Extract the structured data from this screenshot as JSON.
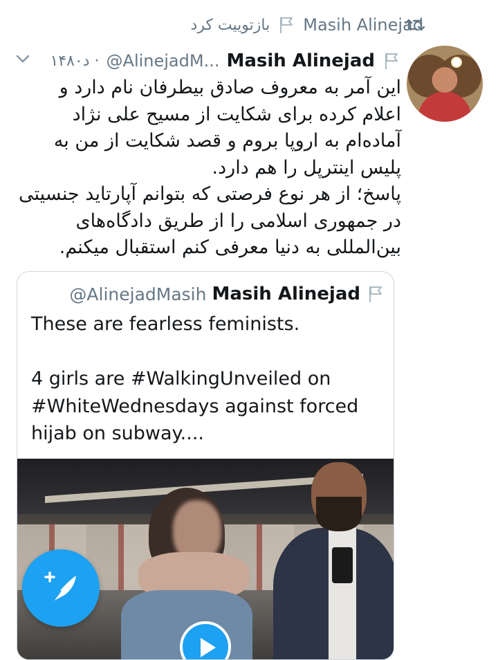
{
  "retweet": {
    "label": "بازتوییت کرد",
    "user": "Masih Alinejad"
  },
  "tweet": {
    "author_name": "Masih Alinejad",
    "handle": "@AlinejadM...",
    "time": "۱۴۸۰د ·",
    "text": "این آمر به معروف صادق بیطرفان نام دارد و اعلام کرده برای شکایت از مسیح علی نژاد آماده‌ام به اروپا بروم و قصد شکایت از من به پلیس اینترپل را هم دارد.\nپاسخ؛ از هر نوع فرصتی که بتوانم آپارتاید جنسیتی در جمهوری اسلامی را از طریق دادگاه‌های بین‌المللی به دنیا معرفی کنم استقبال میکنم."
  },
  "quoted": {
    "author_name": "Masih Alinejad",
    "handle": "@AlinejadMasih",
    "text": "These are fearless feminists.\n\n4 girls are #WalkingUnveiled on #WhiteWednesdays against forced hijab on subway...."
  },
  "colors": {
    "accent": "#1da1f2",
    "secondary_text": "#657786",
    "border": "#ccd6dd"
  },
  "icons": [
    "retweet-icon",
    "flag-icon",
    "chevron-down-icon",
    "play-icon",
    "compose-tweet-icon"
  ]
}
